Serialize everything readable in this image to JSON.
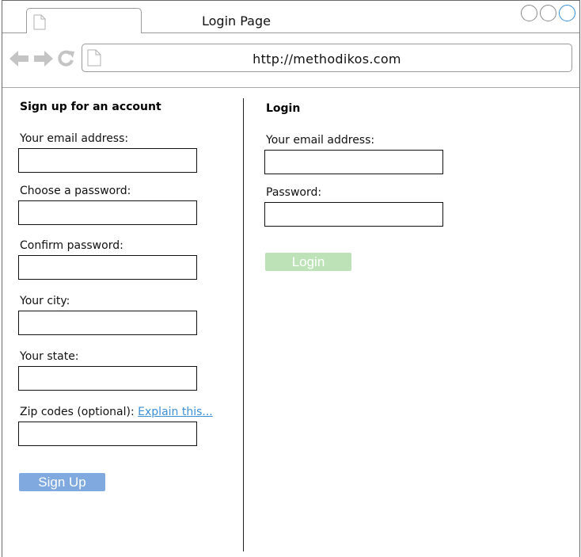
{
  "window": {
    "title": "Login Page",
    "url": "http://methodikos.com"
  },
  "signup": {
    "heading": "Sign up for an account",
    "email_label": "Your email address:",
    "password_label": "Choose a password:",
    "confirm_label": "Confirm password:",
    "city_label": "Your city:",
    "state_label": "Your state:",
    "zip_label": "Zip codes (optional):",
    "zip_help_link": "Explain this...",
    "button_label": "Sign Up",
    "button_color": "#7fa9df"
  },
  "login": {
    "heading": "Login",
    "email_label": "Your email address:",
    "password_label": "Password:",
    "button_label": "Login",
    "button_color": "#bde2b8"
  },
  "icons": {
    "tab": "document-icon",
    "back": "back-arrow-icon",
    "forward": "forward-arrow-icon",
    "reload": "reload-icon",
    "url": "document-icon"
  },
  "colors": {
    "link": "#3b8fd6",
    "active_window_button": "#3a8fd0"
  }
}
